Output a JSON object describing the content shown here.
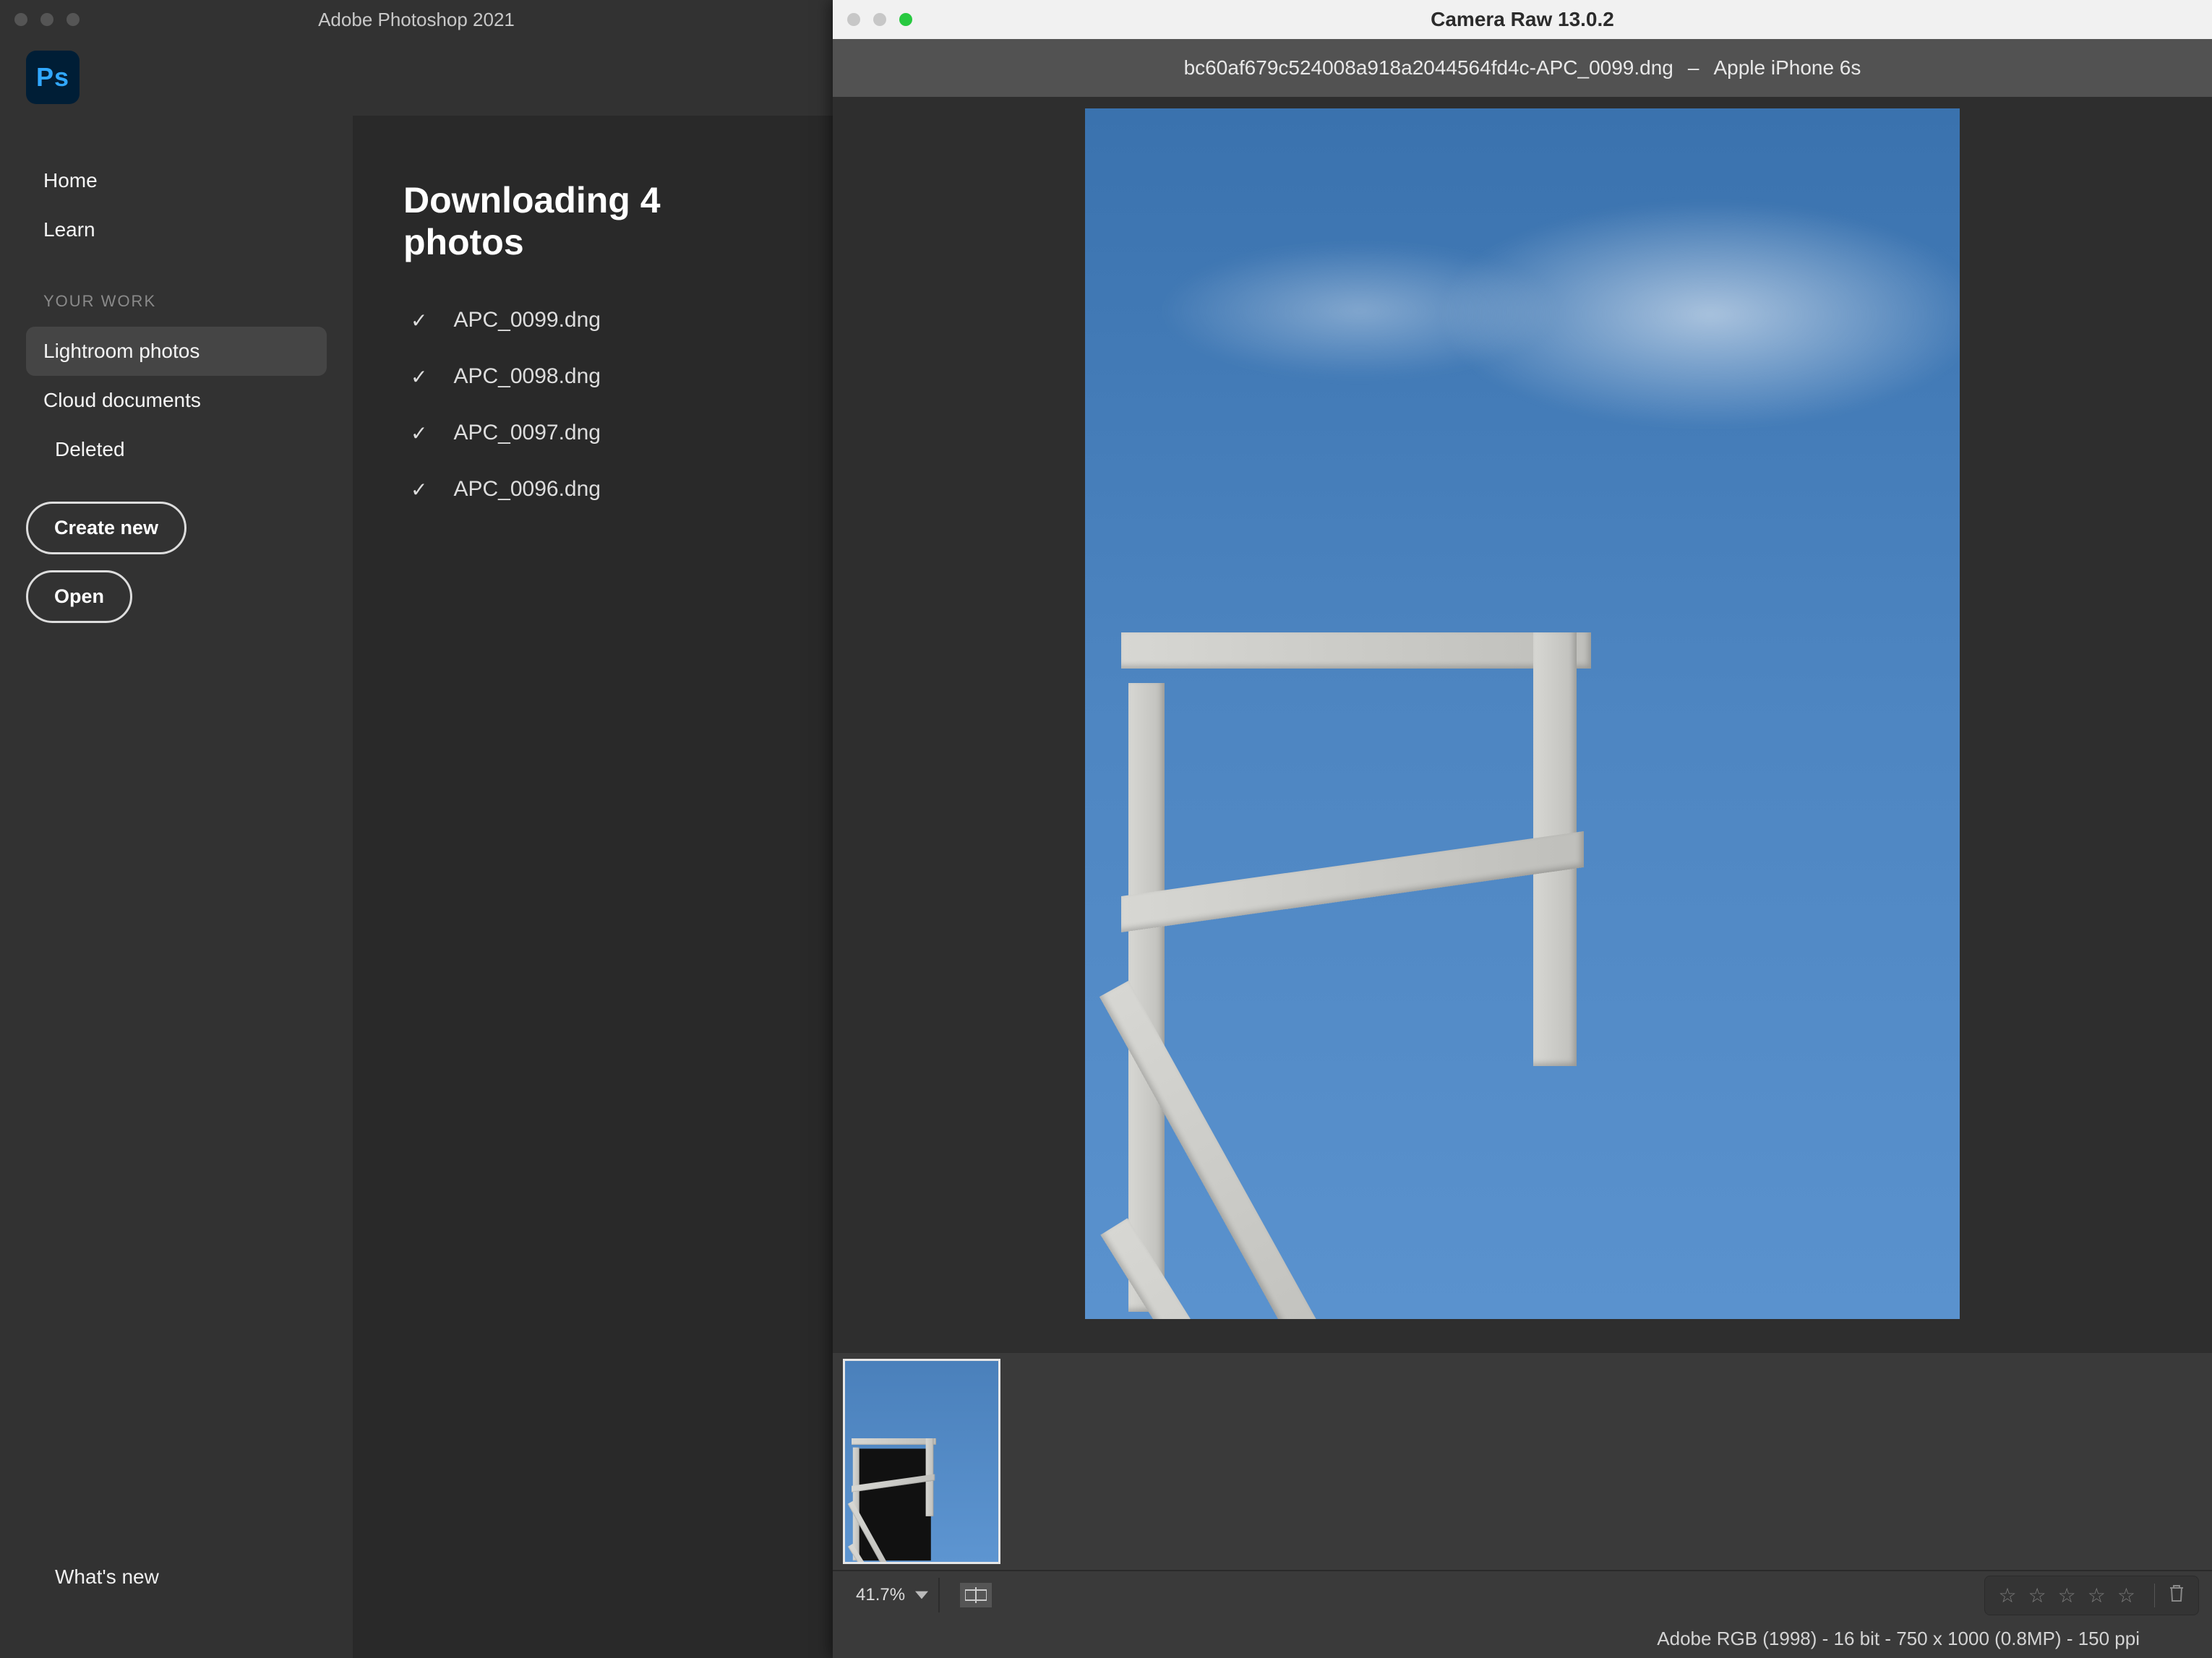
{
  "photoshop": {
    "title": "Adobe Photoshop 2021",
    "logo": "Ps",
    "nav": {
      "home": "Home",
      "learn": "Learn",
      "section_header": "YOUR WORK",
      "lightroom": "Lightroom photos",
      "cloud": "Cloud documents",
      "deleted": "Deleted"
    },
    "actions": {
      "create": "Create new",
      "open": "Open"
    },
    "whatsnew": "What's new",
    "main": {
      "heading": "Downloading 4 photos",
      "files": [
        "APC_0099.dng",
        "APC_0098.dng",
        "APC_0097.dng",
        "APC_0096.dng"
      ]
    }
  },
  "cameraRaw": {
    "title": "Camera Raw 13.0.2",
    "filename": "bc60af679c524008a918a2044564fd4c-APC_0099.dng",
    "sep": "–",
    "camera": "Apple iPhone 6s",
    "zoom": "41.7%",
    "meta": "Adobe RGB (1998) - 16 bit - 750 x 1000 (0.8MP) - 150 ppi"
  }
}
